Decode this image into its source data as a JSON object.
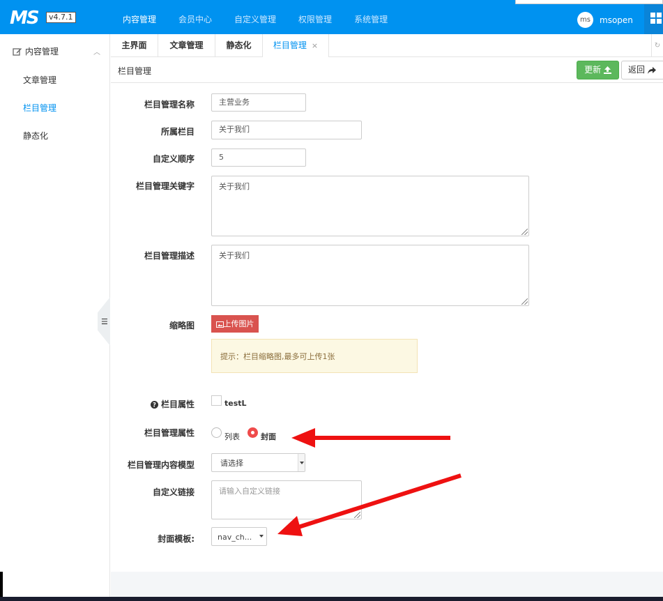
{
  "app": {
    "logo": "MS",
    "version": "v4.7.1"
  },
  "topnav": {
    "items": [
      "内容管理",
      "会员中心",
      "自定义管理",
      "权限管理",
      "系统管理"
    ],
    "active": 0
  },
  "user": {
    "avatar_text": "ms",
    "name": "msopen"
  },
  "sidebar": {
    "group_label": "内容管理",
    "items": [
      "文章管理",
      "栏目管理",
      "静态化"
    ],
    "active": 1,
    "collapse_icon": "indent-icon"
  },
  "tabs": [
    {
      "label": "主界面"
    },
    {
      "label": "文章管理"
    },
    {
      "label": "静态化"
    },
    {
      "label": "栏目管理",
      "close": "×"
    }
  ],
  "page": {
    "title": "栏目管理",
    "update_label": "更新",
    "back_label": "返回"
  },
  "form": {
    "name_label": "栏目管理名称",
    "name_value": "主营业务",
    "parent_label": "所属栏目",
    "parent_value": "关于我们",
    "order_label": "自定义顺序",
    "order_value": "5",
    "keywords_label": "栏目管理关键字",
    "keywords_value": "关于我们",
    "desc_label": "栏目管理描述",
    "desc_value": "关于我们",
    "thumb_label": "缩略图",
    "upload_label": "上传图片",
    "tip": "提示：栏目缩略图,最多可上传1张",
    "attr_label": "栏目属性",
    "attr_checkbox_label": "testL",
    "type_label": "栏目管理属性",
    "type_options": [
      "列表",
      "封面"
    ],
    "type_selected": "封面",
    "model_label": "栏目管理内容模型",
    "model_value": "请选择",
    "link_label": "自定义链接",
    "link_placeholder": "请输入自定义链接",
    "cover_label": "封面模板:",
    "cover_value": "nav_ch..."
  },
  "colors": {
    "brand": "#0092f0",
    "update": "#5cb85c",
    "upload": "#d9534f",
    "annotation": "#ee1111"
  }
}
